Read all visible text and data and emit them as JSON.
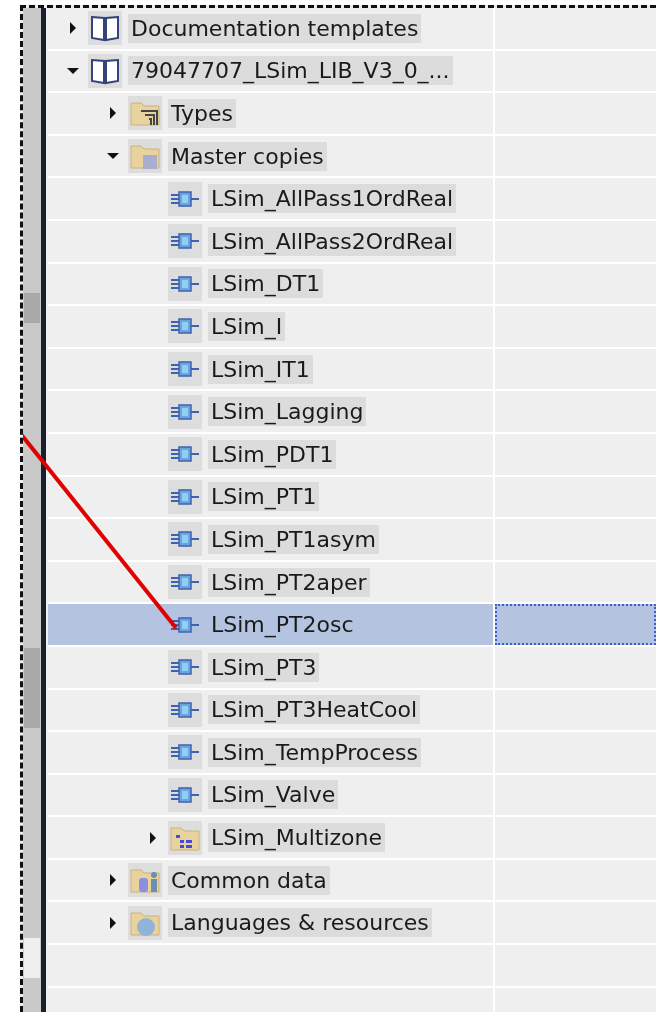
{
  "tree": [
    {
      "label": "Documentation templates",
      "kind": "library",
      "expanded": false,
      "selected": false
    },
    {
      "label": "79047707_LSim_LIB_V3_0_...",
      "kind": "library",
      "expanded": true,
      "selected": false,
      "children": [
        {
          "label": "Types",
          "kind": "types-folder",
          "expanded": false,
          "selected": false
        },
        {
          "label": "Master copies",
          "kind": "folder",
          "expanded": true,
          "selected": false,
          "children": [
            {
              "label": "LSim_AllPass1OrdReal",
              "kind": "block",
              "selected": false
            },
            {
              "label": "LSim_AllPass2OrdReal",
              "kind": "block",
              "selected": false
            },
            {
              "label": "LSim_DT1",
              "kind": "block",
              "selected": false
            },
            {
              "label": "LSim_I",
              "kind": "block",
              "selected": false
            },
            {
              "label": "LSim_IT1",
              "kind": "block",
              "selected": false
            },
            {
              "label": "LSim_Lagging",
              "kind": "block",
              "selected": false
            },
            {
              "label": "LSim_PDT1",
              "kind": "block",
              "selected": false
            },
            {
              "label": "LSim_PT1",
              "kind": "block",
              "selected": false
            },
            {
              "label": "LSim_PT1asym",
              "kind": "block",
              "selected": false
            },
            {
              "label": "LSim_PT2aper",
              "kind": "block",
              "selected": false
            },
            {
              "label": "LSim_PT2osc",
              "kind": "block",
              "selected": true
            },
            {
              "label": "LSim_PT3",
              "kind": "block",
              "selected": false
            },
            {
              "label": "LSim_PT3HeatCool",
              "kind": "block",
              "selected": false
            },
            {
              "label": "LSim_TempProcess",
              "kind": "block",
              "selected": false
            },
            {
              "label": "LSim_Valve",
              "kind": "block",
              "selected": false
            },
            {
              "label": "LSim_Multizone",
              "kind": "group-folder",
              "expanded": false,
              "selected": false
            }
          ]
        },
        {
          "label": "Common data",
          "kind": "data-folder",
          "expanded": false,
          "selected": false
        },
        {
          "label": "Languages & resources",
          "kind": "globe-folder",
          "expanded": false,
          "selected": false
        }
      ]
    }
  ]
}
